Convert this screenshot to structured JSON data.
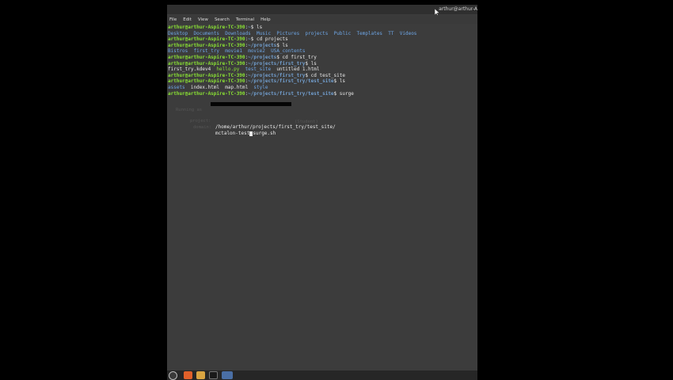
{
  "window": {
    "title": "arthur@arthur-A"
  },
  "menubar": {
    "items": [
      "File",
      "Edit",
      "View",
      "Search",
      "Terminal",
      "Help"
    ]
  },
  "terminal": {
    "prompt_user": "arthur@arthur-Aspire-TC-390",
    "lines": [
      {
        "path": "~",
        "cmd": "ls"
      },
      {
        "output": [
          "Desktop",
          "Documents",
          "Downloads",
          "Music",
          "Pictures",
          "projects",
          "Public",
          "Templates",
          "TT",
          "Videos"
        ]
      },
      {
        "path": "~",
        "cmd": "cd projects"
      },
      {
        "path": "~/projects",
        "cmd": "ls"
      },
      {
        "output": [
          "Bistros",
          "first_try",
          "movie1",
          "movie2",
          "USA_contents"
        ]
      },
      {
        "path": "~/projects",
        "cmd": "cd first_try"
      },
      {
        "path": "~/projects/first_try",
        "cmd": "ls"
      },
      {
        "output": [
          "first_try.kdev4",
          "hello.py",
          "test_site",
          "untitled 1.html"
        ]
      },
      {
        "path": "~/projects/first_try",
        "cmd": "cd test_site"
      },
      {
        "path": "~/projects/first_try/test_site",
        "cmd": "ls"
      },
      {
        "output": [
          "assets",
          "index.html",
          "map.html",
          "style"
        ]
      },
      {
        "path": "~/projects/first_try/test_site",
        "cmd": "surge"
      }
    ],
    "surge": {
      "login_label": "Running as",
      "login_suffix": "(Student)",
      "project_label": "project:",
      "project_value": "/home/arthur/projects/first_try/test_site/",
      "domain_label": "domain:",
      "domain_value_before": "mctalon-test",
      "domain_value_after": "surge.sh"
    }
  },
  "taskbar": {
    "icons": [
      "menu-icon",
      "browser-icon",
      "files-icon",
      "terminal-icon",
      "window-icon"
    ]
  },
  "colors": {
    "prompt_user": "#8ae234",
    "prompt_path": "#729fcf",
    "directory": "#6ea6e6",
    "background": "#3c3c3c"
  }
}
